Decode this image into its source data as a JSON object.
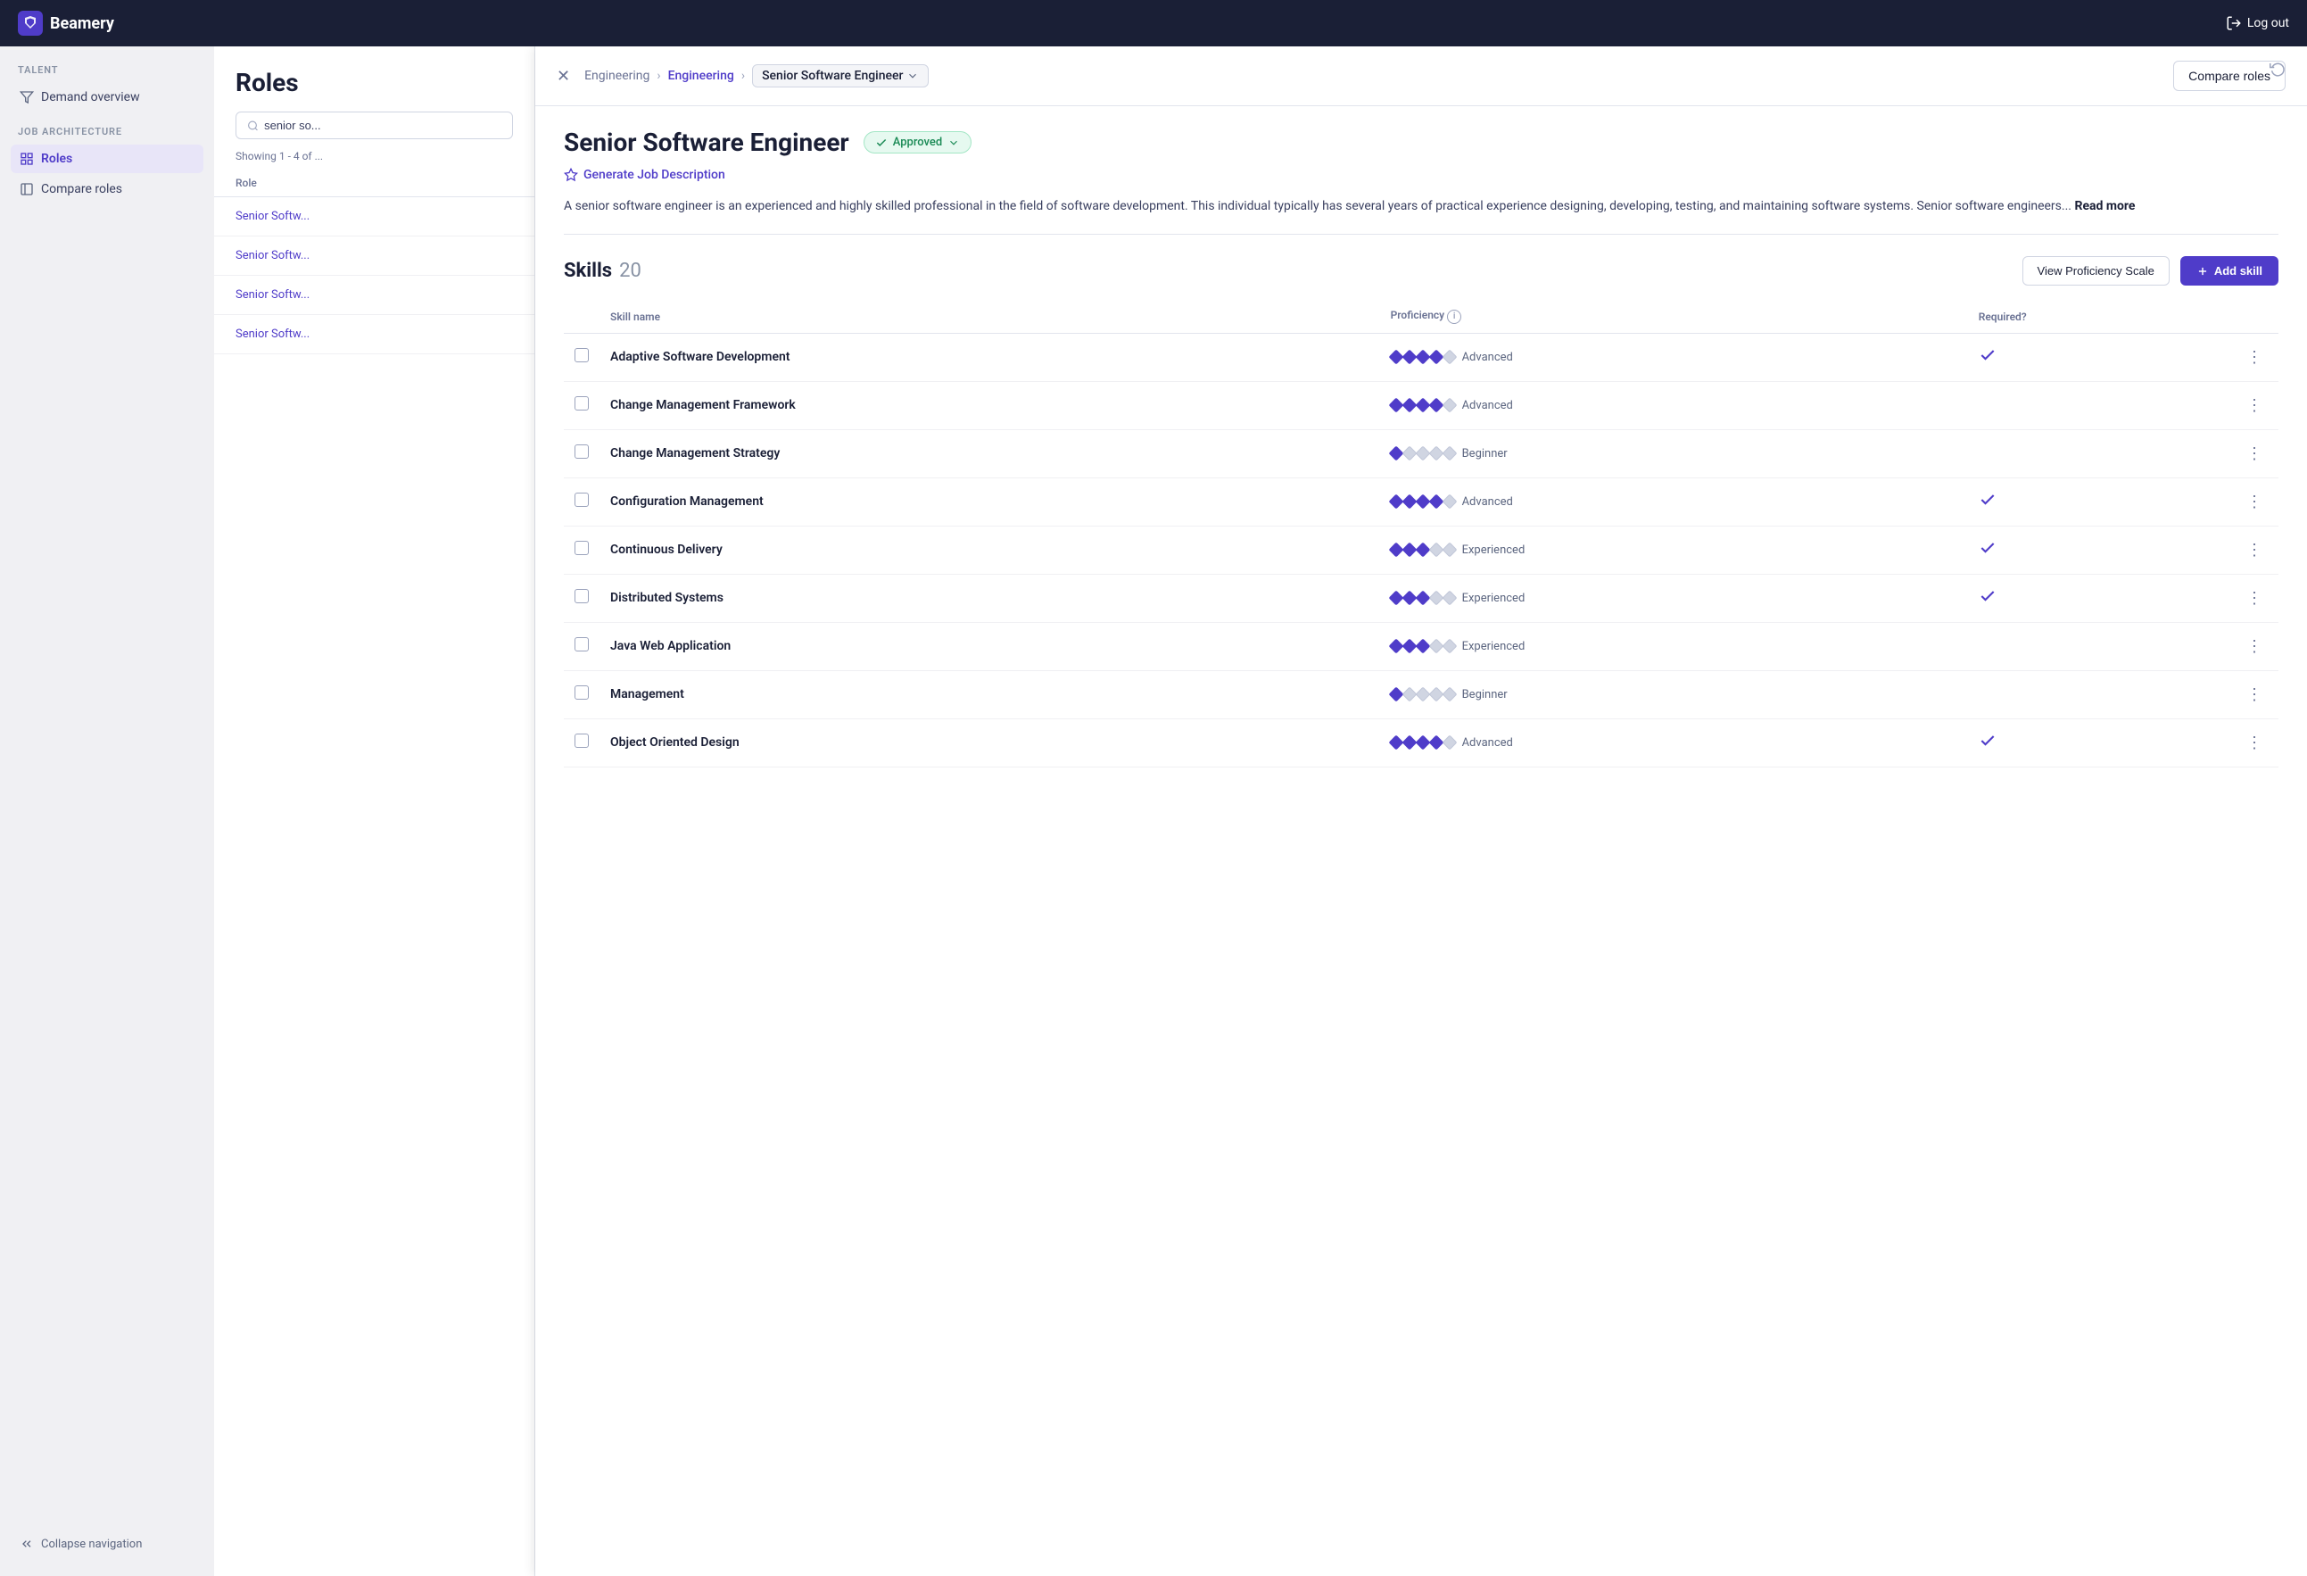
{
  "app": {
    "name": "Beamery",
    "logout_label": "Log out"
  },
  "sidebar": {
    "talent_label": "TALENT",
    "demand_overview_label": "Demand overview",
    "job_architecture_label": "JOB ARCHITECTURE",
    "roles_label": "Roles",
    "compare_roles_label": "Compare roles",
    "collapse_nav_label": "Collapse navigation"
  },
  "roles_panel": {
    "title": "Roles",
    "search_placeholder": "senior so...",
    "showing_text": "Showing 1 - 4 of ...",
    "column_role": "Role",
    "items": [
      {
        "label": "Senior Softw..."
      },
      {
        "label": "Senior Softw..."
      },
      {
        "label": "Senior Softw..."
      },
      {
        "label": "Senior Softw..."
      }
    ]
  },
  "detail": {
    "breadcrumb_1": "Engineering",
    "breadcrumb_2": "Engineering",
    "breadcrumb_current": "Senior Software Engineer",
    "compare_roles_btn": "Compare roles",
    "role_title": "Senior Software Engineer",
    "approved_badge": "Approved",
    "generate_job_description": "Generate Job Description",
    "description": "A senior software engineer is an experienced and highly skilled professional in the field of software development. This individual typically has several years of practical experience designing, developing, testing, and maintaining software systems. Senior software engineers...",
    "read_more": "Read more",
    "skills_label": "Skills",
    "skills_count": "20",
    "view_proficiency_scale_btn": "View Proficiency Scale",
    "add_skill_btn": "+ Add skill",
    "table_headers": {
      "skill_name": "Skill name",
      "proficiency": "Proficiency",
      "required": "Required?"
    },
    "skills": [
      {
        "name": "Adaptive Software Development",
        "proficiency_filled": 4,
        "proficiency_total": 5,
        "proficiency_label": "Advanced",
        "required": true
      },
      {
        "name": "Change Management Framework",
        "proficiency_filled": 4,
        "proficiency_total": 5,
        "proficiency_label": "Advanced",
        "required": false
      },
      {
        "name": "Change Management Strategy",
        "proficiency_filled": 1,
        "proficiency_total": 5,
        "proficiency_label": "Beginner",
        "required": false
      },
      {
        "name": "Configuration Management",
        "proficiency_filled": 4,
        "proficiency_total": 5,
        "proficiency_label": "Advanced",
        "required": true
      },
      {
        "name": "Continuous Delivery",
        "proficiency_filled": 3,
        "proficiency_total": 5,
        "proficiency_label": "Experienced",
        "required": true
      },
      {
        "name": "Distributed Systems",
        "proficiency_filled": 3,
        "proficiency_total": 5,
        "proficiency_label": "Experienced",
        "required": true
      },
      {
        "name": "Java Web Application",
        "proficiency_filled": 3,
        "proficiency_total": 5,
        "proficiency_label": "Experienced",
        "required": false
      },
      {
        "name": "Management",
        "proficiency_filled": 1,
        "proficiency_total": 5,
        "proficiency_label": "Beginner",
        "required": false
      },
      {
        "name": "Object Oriented Design",
        "proficiency_filled": 4,
        "proficiency_total": 5,
        "proficiency_label": "Advanced",
        "required": true
      }
    ]
  },
  "colors": {
    "primary": "#4f3cc9",
    "diamond_filled": "#4f3cc9",
    "diamond_empty": "#d0d5e2"
  }
}
